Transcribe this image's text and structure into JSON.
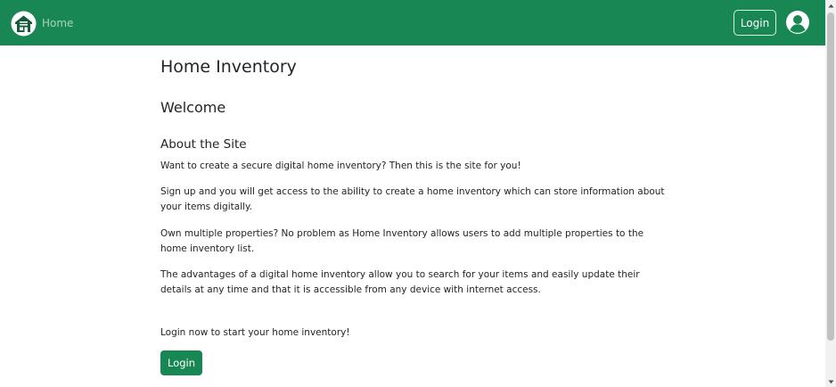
{
  "navbar": {
    "brand_label": "Home",
    "login_label": "Login",
    "bg_color": "#198754",
    "brand_icon": "house-icon",
    "avatar_icon": "user-avatar-icon"
  },
  "main": {
    "title": "Home Inventory",
    "welcome": "Welcome",
    "about_heading": "About the Site",
    "paragraphs": [
      "Want to create a secure digital home inventory? Then this is the site for you!",
      "Sign up and you will get access to the ability to create a home inventory which can store information about your items digitally.",
      "Own multiple properties? No problem as Home Inventory allows users to add multiple properties to the home inventory list.",
      "The advantages of a digital home inventory allow you to search for your items and easily update their details at any time and that it is accessible from any device with internet access."
    ],
    "cta_text": "Login now to start your home inventory!",
    "login_button_label": "Login",
    "accent_color": "#198754"
  },
  "scrollbar": {
    "up_icon": "scroll-up-arrow-icon",
    "down_icon": "scroll-down-arrow-icon"
  }
}
